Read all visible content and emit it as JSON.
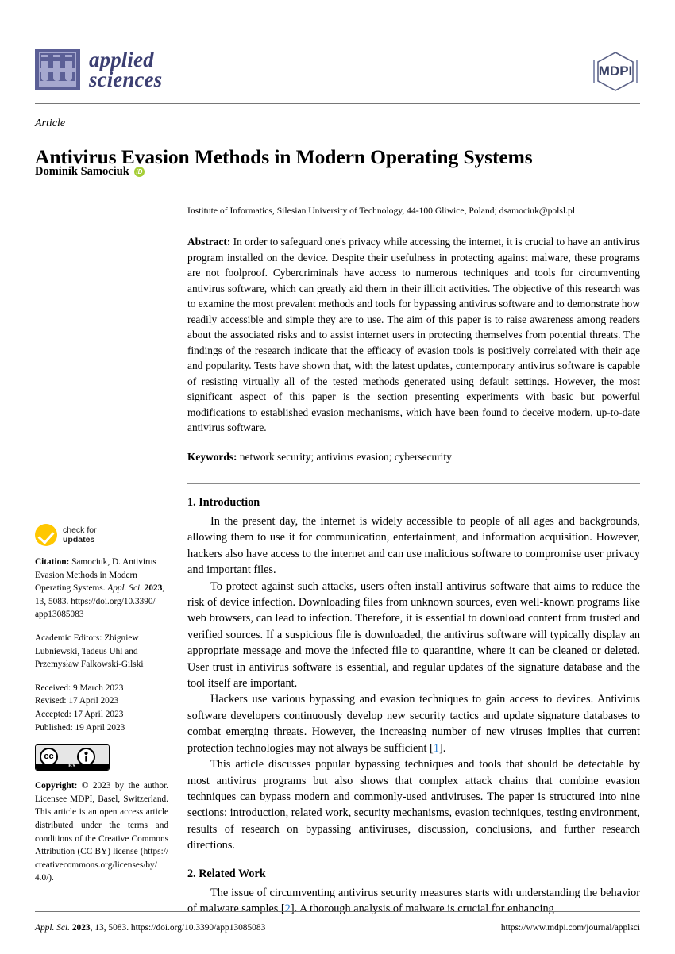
{
  "header": {
    "journal_line1": "applied",
    "journal_line2": "sciences",
    "publisher_logo_text": "MDPI",
    "flask_icon": "test-tube-rack-icon"
  },
  "title_block": {
    "article_kind": "Article",
    "title": "Antivirus Evasion Methods in Modern Operating Systems",
    "author": "Dominik Samociuk",
    "orcid_icon": "orcid-id-icon"
  },
  "affiliation": "Institute of Informatics, Silesian University of Technology, 44-100 Gliwice, Poland; dsamociuk@polsl.pl",
  "abstract": {
    "label": "Abstract:",
    "text": " In order to safeguard one's privacy while accessing the internet, it is crucial to have an antivirus program installed on the device. Despite their usefulness in protecting against malware, these programs are not foolproof. Cybercriminals have access to numerous techniques and tools for circumventing antivirus software, which can greatly aid them in their illicit activities. The objective of this research was to examine the most prevalent methods and tools for bypassing antivirus software and to demonstrate how readily accessible and simple they are to use. The aim of this paper is to raise awareness among readers about the associated risks and to assist internet users in protecting themselves from potential threats. The findings of the research indicate that the efficacy of evasion tools is positively correlated with their age and popularity. Tests have shown that, with the latest updates, contemporary antivirus software is capable of resisting virtually all of the tested methods generated using default settings. However, the most significant aspect of this paper is the section presenting experiments with basic but powerful modifications to established evasion mechanisms, which have been found to deceive modern, up-to-date antivirus software."
  },
  "keywords": {
    "label": "Keywords:",
    "text": " network security; antivirus evasion; cybersecurity"
  },
  "sections": {
    "intro_heading": "1. Introduction",
    "intro_p1": "In the present day, the internet is widely accessible to people of all ages and backgrounds, allowing them to use it for communication, entertainment, and information acquisition. However, hackers also have access to the internet and can use malicious software to compromise user privacy and important files.",
    "intro_p2": "To protect against such attacks, users often install antivirus software that aims to reduce the risk of device infection. Downloading files from unknown sources, even well-known programs like web browsers, can lead to infection. Therefore, it is essential to download content from trusted and verified sources. If a suspicious file is downloaded, the antivirus software will typically display an appropriate message and move the infected file to quarantine, where it can be cleaned or deleted. User trust in antivirus software is essential, and regular updates of the signature database and the tool itself are important.",
    "intro_p3_before": "Hackers use various bypassing and evasion techniques to gain access to devices. Antivirus software developers continuously develop new security tactics and update signature databases to combat emerging threats. However, the increasing number of new viruses implies that current protection technologies may not always be sufficient [",
    "intro_p3_cite": "1",
    "intro_p3_after": "].",
    "intro_p4": "This article discusses popular bypassing techniques and tools that should be detectable by most antivirus programs but also shows that complex attack chains that combine evasion techniques can bypass modern and commonly-used antiviruses. The paper is structured into nine sections: introduction, related work, security mechanisms, evasion techniques, testing environment, results of research on bypassing antiviruses, discussion, conclusions, and further research directions.",
    "related_heading": "2. Related Work",
    "related_p1_before": "The issue of circumventing antivirus security measures starts with understanding the behavior of malware samples [",
    "related_p1_cite": "2",
    "related_p1_after": "]. A thorough analysis of malware is crucial for enhancing"
  },
  "sidebar": {
    "check_updates_line1": "check for",
    "check_updates_line2": "updates",
    "check_icon": "check-for-updates-icon",
    "citation_label": "Citation:",
    "citation_l1": " Samociuk, D. Antivirus",
    "citation_l2": "Evasion Methods in Modern",
    "citation_l3_a": "Operating Systems. ",
    "citation_l3_b": "Appl. Sci.",
    "citation_l3_c": " 2023",
    "citation_l3_d": ",",
    "citation_l4": "13, 5083.  https://doi.org/10.3390/",
    "citation_l5": "app13085083",
    "editors_l1": "Academic Editors: Zbigniew",
    "editors_l2": "Lubniewski, Tadeus Uhl and",
    "editors_l3": "Przemysław Falkowski-Gilski",
    "received": "Received: 9 March 2023",
    "revised": "Revised: 17 April 2023",
    "accepted": "Accepted: 17 April 2023",
    "published": "Published: 19 April 2023",
    "cc_icon": "creative-commons-by-icon",
    "cc_cc": "cc",
    "cc_person": "\u0001",
    "cc_by": "BY",
    "copyright_label": "Copyright:",
    "copyright_text": " © 2023 by the author. Licensee MDPI, Basel, Switzerland. This article is an open access article distributed under the terms and conditions of the Creative Commons Attribution (CC BY) license (https:// creativecommons.org/licenses/by/ 4.0/)."
  },
  "footer": {
    "left_journal": "Appl. Sci.",
    "left_year": " 2023",
    "left_rest": ", 13, 5083. https://doi.org/10.3390/app13085083",
    "right": "https://www.mdpi.com/journal/applsci"
  },
  "colors": {
    "journal_purple": "#3c3f72",
    "logo_fill": "#5b5f96",
    "logo_light": "#a6a8cf",
    "citation_blue": "#2b7fd4",
    "orcid_green": "#a6ce39",
    "check_yellow": "#ffc700"
  }
}
